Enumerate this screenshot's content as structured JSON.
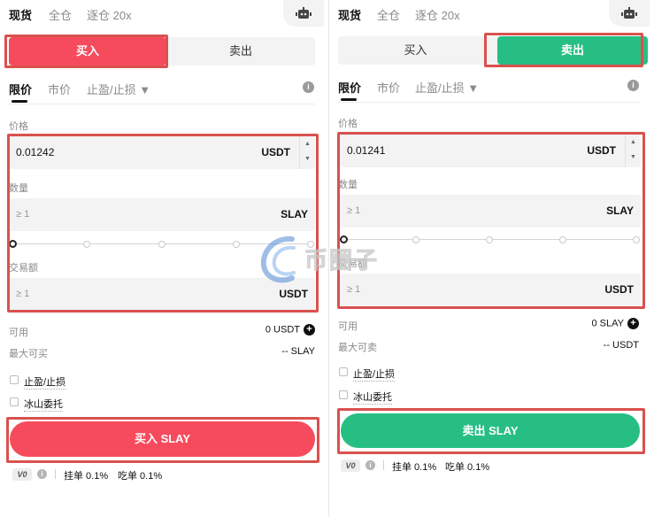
{
  "left": {
    "top_tabs": [
      "现货",
      "全仓",
      "逐仓 20x"
    ],
    "side_tabs": {
      "buy": "买入",
      "sell": "卖出",
      "active": "buy"
    },
    "order_types": {
      "limit": "限价",
      "market": "市价",
      "tpsl": "止盈/止损 ▼"
    },
    "price": {
      "label": "价格",
      "value": "0.01242",
      "unit": "USDT"
    },
    "quantity": {
      "label": "数量",
      "placeholder": "≥ 1",
      "unit": "SLAY",
      "slider_fraction": 0
    },
    "total": {
      "label": "交易额",
      "placeholder": "≥ 1",
      "unit": "USDT"
    },
    "available": {
      "label": "可用",
      "value": "0 USDT"
    },
    "max": {
      "label": "最大可买",
      "value": "-- SLAY"
    },
    "checkboxes": [
      "止盈/止损",
      "冰山委托"
    ],
    "action": "买入 SLAY",
    "fees": {
      "level": "V0",
      "maker": "挂单 0.1%",
      "taker": "吃单 0.1%"
    }
  },
  "right": {
    "top_tabs": [
      "现货",
      "全仓",
      "逐仓 20x"
    ],
    "side_tabs": {
      "buy": "买入",
      "sell": "卖出",
      "active": "sell"
    },
    "order_types": {
      "limit": "限价",
      "market": "市价",
      "tpsl": "止盈/止损 ▼"
    },
    "price": {
      "label": "价格",
      "value": "0.01241",
      "unit": "USDT"
    },
    "quantity": {
      "label": "数量",
      "placeholder": "≥ 1",
      "unit": "SLAY",
      "slider_fraction": 0
    },
    "total": {
      "label": "交易额",
      "placeholder": "≥ 1",
      "unit": "USDT"
    },
    "available": {
      "label": "可用",
      "value": "0 SLAY"
    },
    "max": {
      "label": "最大可卖",
      "value": "-- USDT"
    },
    "checkboxes": [
      "止盈/止损",
      "冰山委托"
    ],
    "action": "卖出 SLAY",
    "fees": {
      "level": "V0",
      "maker": "挂单 0.1%",
      "taker": "吃单 0.1%"
    }
  },
  "watermark": "币圈子",
  "colors": {
    "buy": "#f64b5d",
    "sell": "#27be83",
    "highlight_box": "#d9514e"
  },
  "icons": {
    "bot": "robot-icon",
    "info": "info-icon",
    "plus": "plus-circle-icon",
    "stepper": "stepper-arrows-icon"
  }
}
